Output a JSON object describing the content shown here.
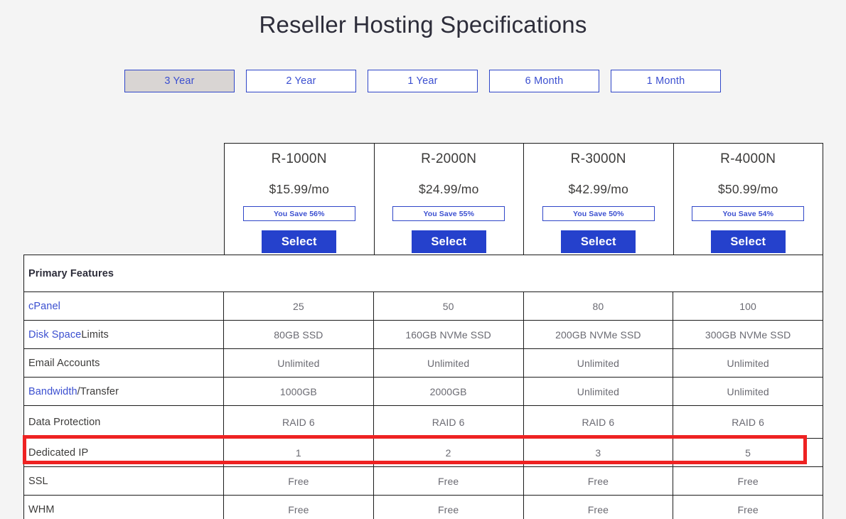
{
  "page": {
    "title": "Reseller Hosting Specifications",
    "background_color": "#f4f4f4",
    "accent_blue": "#2541cc",
    "link_blue": "#3b4fd0",
    "highlight_color": "#ee2222"
  },
  "term_selector": {
    "selected": "3 Year",
    "options": [
      {
        "label": "3 Year",
        "active": true
      },
      {
        "label": "2 Year",
        "active": false
      },
      {
        "label": "1 Year",
        "active": false
      },
      {
        "label": "6 Month",
        "active": false
      },
      {
        "label": "1 Month",
        "active": false
      }
    ]
  },
  "plans": [
    {
      "name": "R-1000N",
      "price": "$15.99/mo",
      "save": "You Save 56%",
      "select_label": "Select"
    },
    {
      "name": "R-2000N",
      "price": "$24.99/mo",
      "save": "You Save 55%",
      "select_label": "Select"
    },
    {
      "name": "R-3000N",
      "price": "$42.99/mo",
      "save": "You Save 50%",
      "select_label": "Select"
    },
    {
      "name": "R-4000N",
      "price": "$50.99/mo",
      "save": "You Save 54%",
      "select_label": "Select"
    }
  ],
  "section": {
    "title": "Primary Features"
  },
  "features": [
    {
      "label": "cPanel",
      "link_part": "cPanel",
      "plain_part": "",
      "values": [
        "25",
        "50",
        "80",
        "100"
      ]
    },
    {
      "label": "Disk Space Limits",
      "link_part": "Disk Space",
      "plain_part": " Limits",
      "values": [
        "80GB SSD",
        "160GB NVMe SSD",
        "200GB NVMe SSD",
        "300GB NVMe SSD"
      ]
    },
    {
      "label": "Email Accounts",
      "link_part": "",
      "plain_part": "Email Accounts",
      "values": [
        "Unlimited",
        "Unlimited",
        "Unlimited",
        "Unlimited"
      ]
    },
    {
      "label": "Bandwidth/Transfer",
      "link_part": "Bandwidth",
      "plain_part": "/Transfer",
      "values": [
        "1000GB",
        "2000GB",
        "Unlimited",
        "Unlimited"
      ]
    },
    {
      "label": "Data Protection",
      "link_part": "",
      "plain_part": "Data Protection",
      "values": [
        "RAID 6",
        "RAID 6",
        "RAID 6",
        "RAID 6"
      ]
    },
    {
      "label": "Dedicated IP",
      "link_part": "",
      "plain_part": "Dedicated IP",
      "values": [
        "1",
        "2",
        "3",
        "5"
      ],
      "highlighted": true
    },
    {
      "label": "SSL",
      "link_part": "",
      "plain_part": "SSL",
      "values": [
        "Free",
        "Free",
        "Free",
        "Free"
      ]
    },
    {
      "label": "WHM",
      "link_part": "",
      "plain_part": "WHM",
      "values": [
        "Free",
        "Free",
        "Free",
        "Free"
      ]
    }
  ]
}
